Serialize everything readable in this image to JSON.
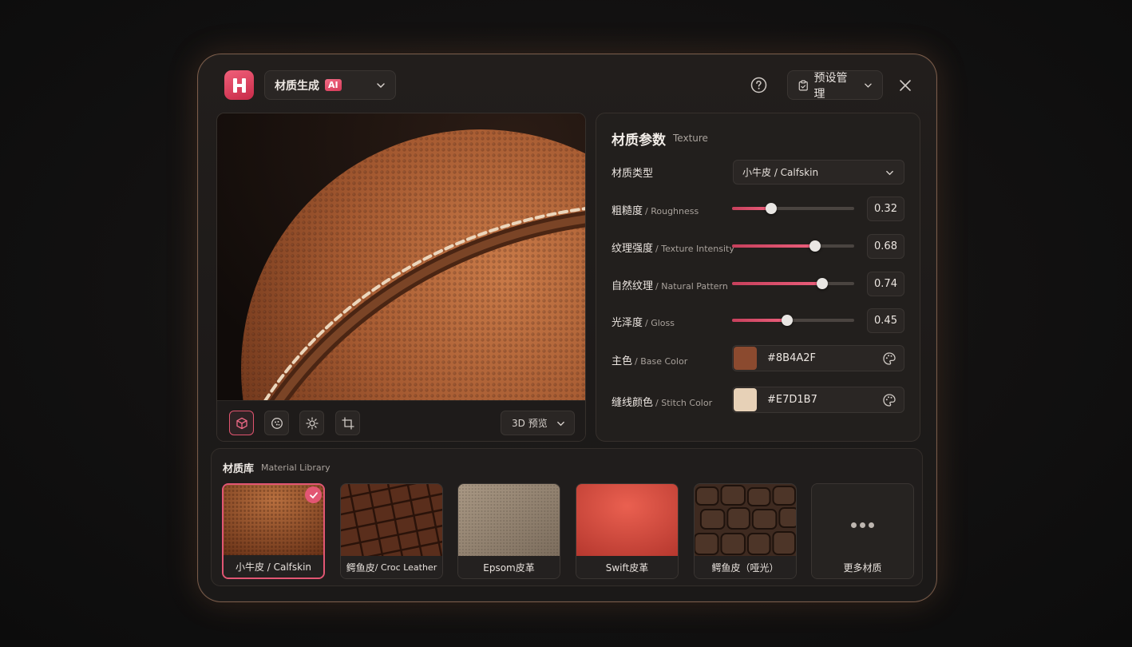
{
  "header": {
    "mode_label": "材质生成",
    "ai_badge": "AI",
    "preset_label": "预设管理"
  },
  "preview": {
    "view_mode": "3D 预览",
    "tools": [
      "cube-icon",
      "texture-icon",
      "light-icon",
      "crop-icon"
    ]
  },
  "params": {
    "title": "材质参数",
    "subtitle": "Texture",
    "material_type": {
      "label": "材质类型",
      "value": "小牛皮 / Calfskin"
    },
    "sliders": [
      {
        "label": "粗糙度",
        "en": "/ Roughness",
        "value": 0.32,
        "display": "0.32"
      },
      {
        "label": "纹理强度",
        "en": "/ Texture Intensity",
        "value": 0.68,
        "display": "0.68"
      },
      {
        "label": "自然纹理",
        "en": "/ Natural Pattern",
        "value": 0.74,
        "display": "0.74"
      },
      {
        "label": "光泽度",
        "en": "/ Gloss",
        "value": 0.45,
        "display": "0.45"
      }
    ],
    "colors": [
      {
        "label": "主色",
        "en": "/ Base Color",
        "hex": "#8B4A2F"
      },
      {
        "label": "缝线颜色",
        "en": "/ Stitch Color",
        "hex": "#E7D1B7"
      }
    ]
  },
  "library": {
    "title": "材质库",
    "subtitle": "Material Library",
    "items": [
      {
        "label": "小牛皮 / Calfskin",
        "selected": true
      },
      {
        "zh": "鳄鱼皮",
        "en": " / Croc Leather"
      },
      {
        "label": "Epsom皮革"
      },
      {
        "label": "Swift皮革"
      },
      {
        "label": "鳄鱼皮（哑光）"
      },
      {
        "label": "更多材质"
      }
    ]
  },
  "colors": {
    "accent": "#E25673",
    "leather": "#8B4A2F",
    "stitch": "#E7D1B7"
  }
}
